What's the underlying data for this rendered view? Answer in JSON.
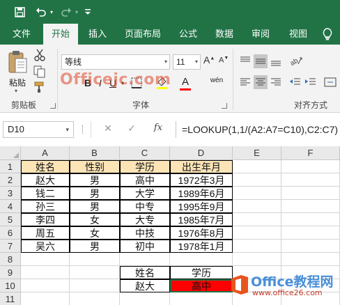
{
  "quick_access": {
    "save_icon": "save-icon",
    "undo_icon": "undo-icon",
    "redo_icon": "redo-icon"
  },
  "tabs": [
    {
      "label": "文件"
    },
    {
      "label": "开始"
    },
    {
      "label": "插入"
    },
    {
      "label": "页面布局"
    },
    {
      "label": "公式"
    },
    {
      "label": "数据"
    },
    {
      "label": "审阅"
    },
    {
      "label": "视图"
    }
  ],
  "ribbon": {
    "clipboard": {
      "paste_label": "粘贴",
      "group_label": "剪贴板"
    },
    "font": {
      "font_name": "等线",
      "font_size": "11",
      "group_label": "字体",
      "bold": "B",
      "italic": "I",
      "underline": "U",
      "font_color_letter": "A",
      "phonetic": "wén",
      "watermark": "Officejc.com"
    },
    "alignment": {
      "group_label": "对齐方式"
    }
  },
  "formula_bar": {
    "name_box": "D10",
    "cancel": "✕",
    "enter": "✓",
    "fx": "fx",
    "formula": "=LOOKUP(1,1/(A2:A7=C10),C2:C7)"
  },
  "sheet": {
    "columns": [
      "A",
      "B",
      "C",
      "D",
      "E",
      "F"
    ],
    "rows": [
      "1",
      "2",
      "3",
      "4",
      "5",
      "6",
      "7",
      "8",
      "9",
      "10",
      "11"
    ],
    "header": [
      "姓名",
      "性别",
      "学历",
      "出生年月"
    ],
    "data": [
      [
        "赵大",
        "男",
        "高中",
        "1972年3月"
      ],
      [
        "钱二",
        "男",
        "大学",
        "1989年6月"
      ],
      [
        "孙三",
        "男",
        "中专",
        "1995年9月"
      ],
      [
        "李四",
        "女",
        "大专",
        "1985年7月"
      ],
      [
        "周五",
        "女",
        "中技",
        "1976年8月"
      ],
      [
        "吴六",
        "男",
        "初中",
        "1978年1月"
      ]
    ],
    "lookup": {
      "label_name": "姓名",
      "label_edu": "学历",
      "name": "赵大",
      "result": "高中",
      "result_fill": "#ff0000"
    },
    "header_fill": "#fce4b6"
  },
  "watermark": {
    "text": "Office教程网",
    "url": "www.office26.com"
  },
  "colors": {
    "brand": "#217346"
  }
}
